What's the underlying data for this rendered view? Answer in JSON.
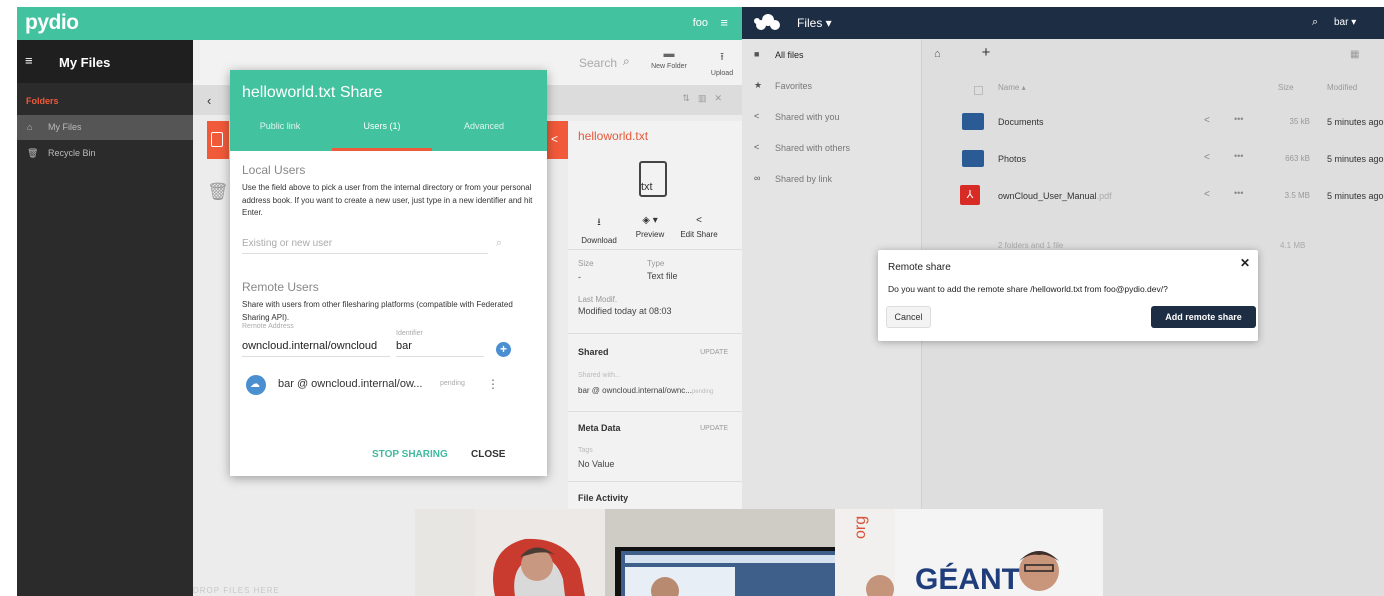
{
  "pydio": {
    "logo": "pydio",
    "user": "foo",
    "user_menu_icon": "hamburger-icon",
    "sidebar": {
      "title": "My Files",
      "folders_label": "Folders",
      "items": [
        {
          "label": "My Files",
          "icon": "home-icon"
        },
        {
          "label": "Recycle Bin",
          "icon": "trash-icon"
        }
      ]
    },
    "toolbar": {
      "search_label": "Search",
      "new_folder_label": "New Folder",
      "upload_label": "Upload"
    },
    "drop_hint": "DROP FILES HERE",
    "details": {
      "filename": "helloworld.txt",
      "filetype": "txt",
      "actions": {
        "download": "Download",
        "preview": "Preview",
        "edit_share": "Edit Share"
      },
      "size_label": "Size",
      "size_value": "-",
      "type_label": "Type",
      "type_value": "Text file",
      "last_modif_label": "Last Modif.",
      "last_modif_value": "Modified today at 08:03",
      "shared_title": "Shared",
      "shared_update": "UPDATE",
      "shared_with_label": "Shared with...",
      "shared_with_value": "bar @ owncloud.internal/ownc...",
      "shared_with_status": "pending",
      "meta_title": "Meta Data",
      "meta_update": "UPDATE",
      "tags_label": "Tags",
      "tags_value": "No Value",
      "activity_title": "File Activity"
    },
    "share_dialog": {
      "title": "helloworld.txt Share",
      "tabs": [
        "Public link",
        "Users (1)",
        "Advanced"
      ],
      "active_tab": "Users (1)",
      "local_title": "Local Users",
      "local_help": "Use the field above to pick a user from the internal directory or from your personal address book. If you want to create a new user, just type in a new identifier and hit Enter.",
      "user_input_placeholder": "Existing or new user",
      "remote_title": "Remote Users",
      "remote_help": "Share with users from other filesharing platforms (compatible with Federated Sharing API).",
      "remote_address_label": "Remote Address",
      "remote_address_value": "owncloud.internal/owncloud",
      "identifier_label": "Identifier",
      "identifier_value": "bar",
      "share_entry": {
        "name": "bar @ owncloud.internal/ow...",
        "status": "pending"
      },
      "stop_button": "STOP SHARING",
      "close_button": "CLOSE"
    }
  },
  "owncloud": {
    "app_name": "Files",
    "user": "bar",
    "nav": [
      {
        "label": "All files",
        "icon": "folder-icon"
      },
      {
        "label": "Favorites",
        "icon": "star-icon"
      },
      {
        "label": "Shared with you",
        "icon": "share-icon"
      },
      {
        "label": "Shared with others",
        "icon": "share-icon"
      },
      {
        "label": "Shared by link",
        "icon": "link-icon"
      }
    ],
    "columns": {
      "name": "Name",
      "size": "Size",
      "modified": "Modified"
    },
    "files": [
      {
        "name": "Documents",
        "ext": "",
        "size": "35 kB",
        "modified": "5 minutes ago",
        "type": "folder"
      },
      {
        "name": "Photos",
        "ext": "",
        "size": "663 kB",
        "modified": "5 minutes ago",
        "type": "folder"
      },
      {
        "name": "ownCloud_User_Manual",
        "ext": ".pdf",
        "size": "3.5 MB",
        "modified": "5 minutes ago",
        "type": "pdf"
      }
    ],
    "summary": "2 folders and 1 file",
    "summary_size": "4.1 MB",
    "remote_dialog": {
      "title": "Remote share",
      "message": "Do you want to add the remote share /helloworld.txt from foo@pydio.dev/?",
      "cancel": "Cancel",
      "confirm": "Add remote share"
    }
  },
  "photo": {
    "banner_text": "GÉANT",
    "banner_side_text": "org"
  },
  "colors": {
    "pydio_accent": "#42c29e",
    "pydio_orange": "#f05a3a",
    "owncloud_header": "#1d2d44",
    "owncloud_folder": "#2b5b95"
  }
}
